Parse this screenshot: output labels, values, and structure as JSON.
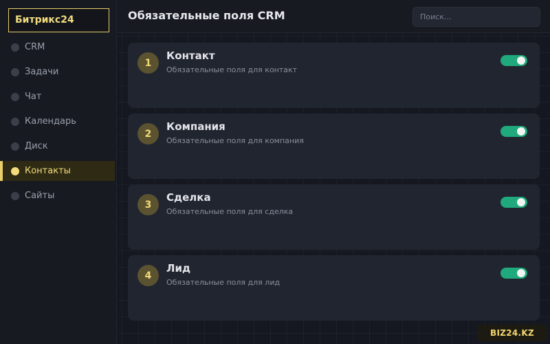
{
  "brand": "Битрикс24",
  "sidebar": {
    "items": [
      {
        "label": "CRM",
        "active": false
      },
      {
        "label": "Задачи",
        "active": false
      },
      {
        "label": "Чат",
        "active": false
      },
      {
        "label": "Календарь",
        "active": false
      },
      {
        "label": "Диск",
        "active": false
      },
      {
        "label": "Контакты",
        "active": true
      },
      {
        "label": "Сайты",
        "active": false
      }
    ]
  },
  "header": {
    "title": "Обязательные поля CRM",
    "search_placeholder": "Поиск..."
  },
  "cards": [
    {
      "number": "1",
      "title": "Контакт",
      "subtitle": "Обязательные поля для контакт",
      "enabled": true
    },
    {
      "number": "2",
      "title": "Компания",
      "subtitle": "Обязательные поля для компания",
      "enabled": true
    },
    {
      "number": "3",
      "title": "Сделка",
      "subtitle": "Обязательные поля для сделка",
      "enabled": true
    },
    {
      "number": "4",
      "title": "Лид",
      "subtitle": "Обязательные поля для лид",
      "enabled": true
    }
  ],
  "footer_badge": "BIZ24.KZ",
  "colors": {
    "accent": "#e8cf6a",
    "toggle_on": "#1fa97c",
    "background": "#14171e",
    "card": "#212530"
  }
}
